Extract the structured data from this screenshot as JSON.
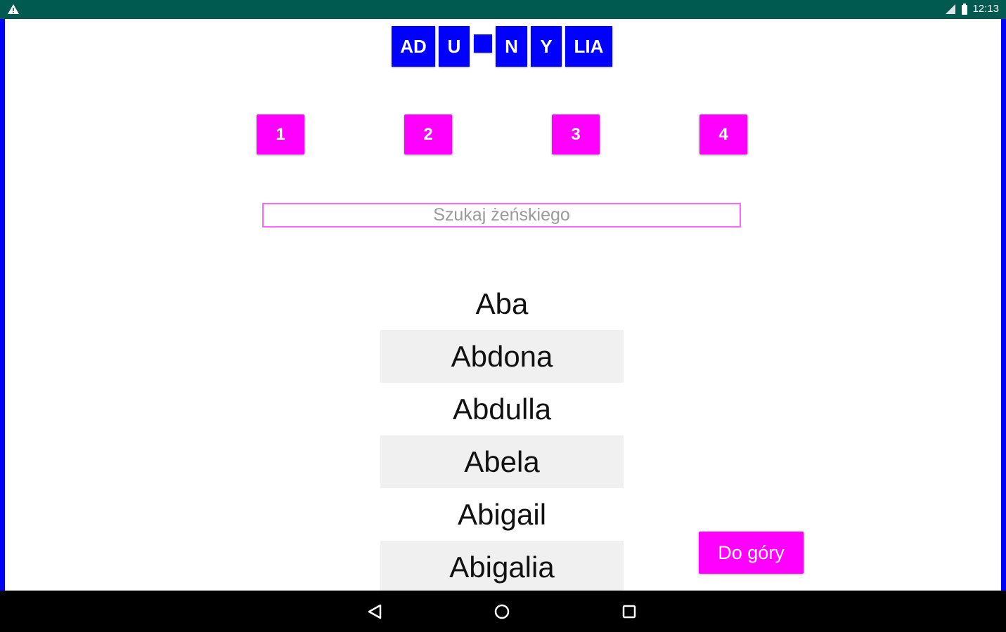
{
  "status_bar": {
    "time": "12:13",
    "icons": [
      "warning-icon",
      "signal-icon",
      "battery-icon"
    ]
  },
  "tiles": [
    {
      "label": "AD"
    },
    {
      "label": "U"
    },
    {
      "label": ""
    },
    {
      "label": "N"
    },
    {
      "label": "Y"
    },
    {
      "label": "LIA"
    }
  ],
  "number_buttons": [
    "1",
    "2",
    "3",
    "4"
  ],
  "search": {
    "placeholder": "Szukaj żeńskiego",
    "value": ""
  },
  "names": [
    "Aba",
    "Abdona",
    "Abdulla",
    "Abela",
    "Abigail",
    "Abigalia"
  ],
  "up_button": {
    "label": "Do góry"
  },
  "nav": {
    "icons": [
      "back-icon",
      "home-icon",
      "recents-icon"
    ]
  },
  "colors": {
    "status_bar": "#005a50",
    "tile": "#0000ff",
    "accent": "#ff00ff",
    "frame": "#0000ff",
    "row_alt": "#f0f0f0"
  }
}
